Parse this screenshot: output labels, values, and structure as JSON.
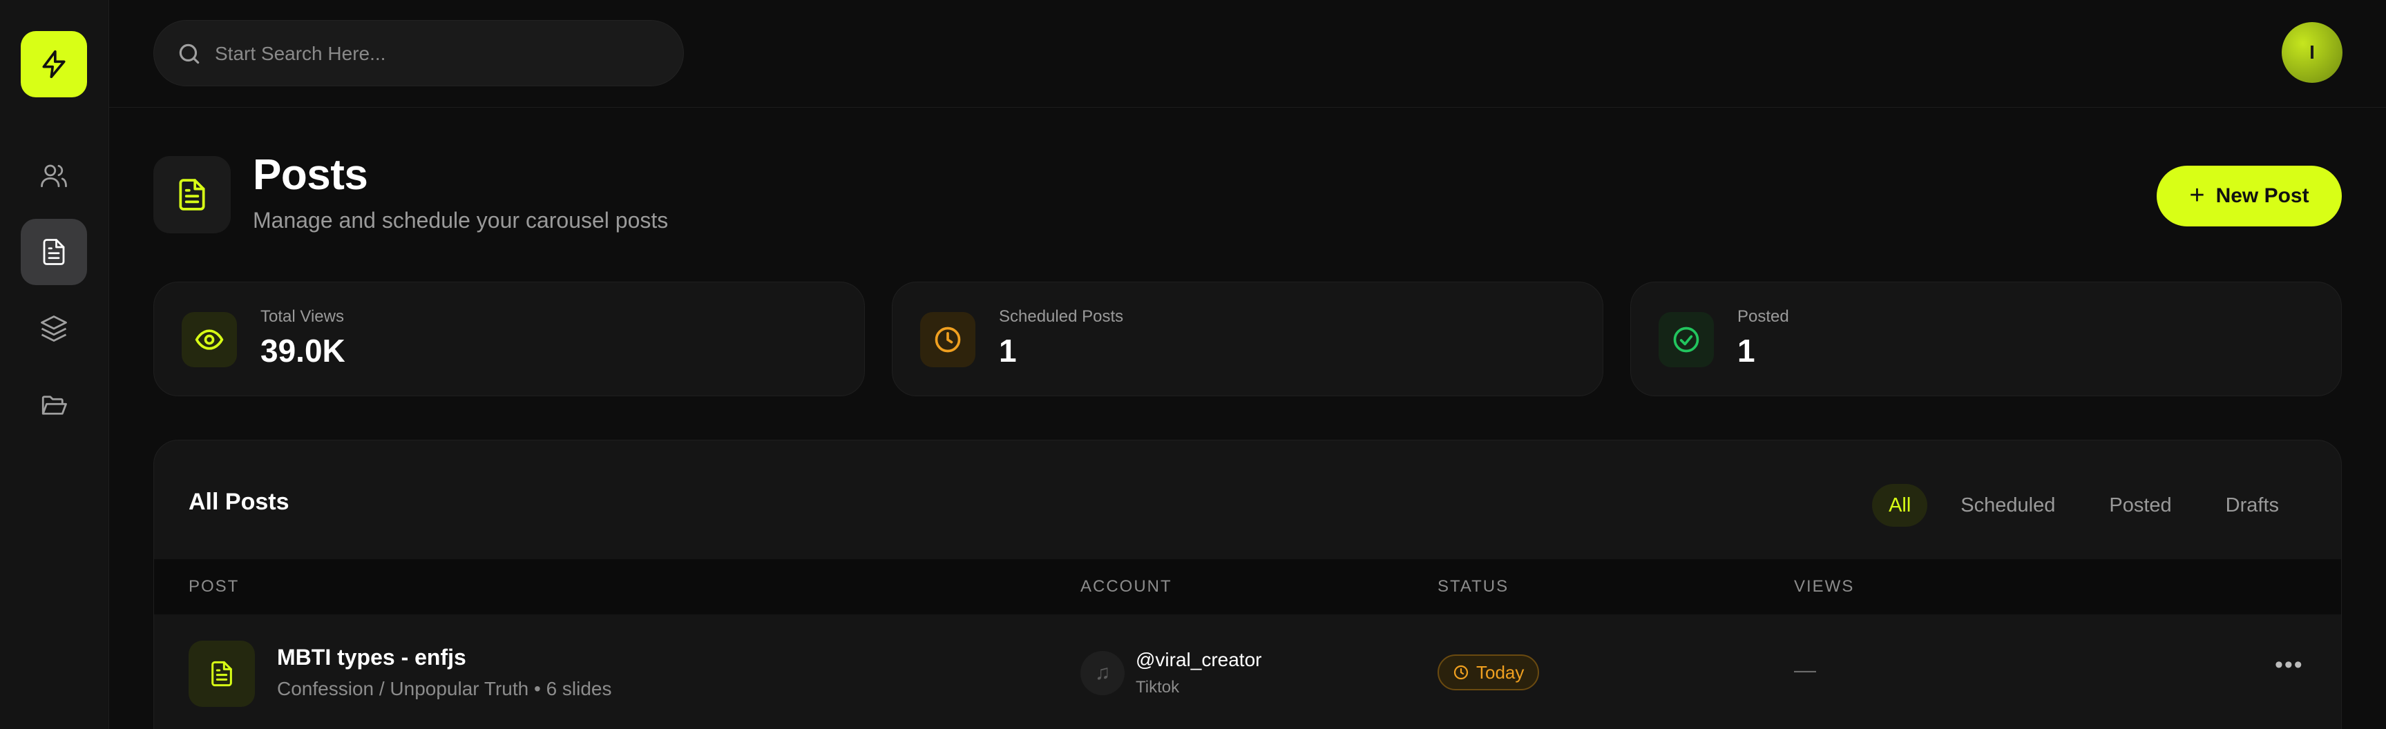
{
  "search": {
    "placeholder": "Start Search Here..."
  },
  "user": {
    "avatar_initial": "I"
  },
  "header": {
    "title": "Posts",
    "subtitle": "Manage and schedule your carousel posts",
    "new_post_label": "New Post"
  },
  "stats": [
    {
      "label": "Total Views",
      "value": "39.0K",
      "color": "#d8ff16",
      "icon": "eye-icon"
    },
    {
      "label": "Scheduled Posts",
      "value": "1",
      "color": "#f0a020",
      "icon": "clock-icon"
    },
    {
      "label": "Posted",
      "value": "1",
      "color": "#22c55e",
      "icon": "check-circle-icon"
    }
  ],
  "posts_panel": {
    "title": "All Posts",
    "filters": [
      "All",
      "Scheduled",
      "Posted",
      "Drafts"
    ],
    "active_filter": "All",
    "columns": [
      "POST",
      "ACCOUNT",
      "STATUS",
      "VIEWS"
    ],
    "rows": [
      {
        "title": "MBTI types - enfjs",
        "meta": "Confession / Unpopular Truth • 6 slides",
        "account_handle": "@viral_creator",
        "account_platform": "Tiktok",
        "status": "Today",
        "views": "—"
      }
    ]
  },
  "colors": {
    "accent": "#d8ff16",
    "background": "#0d0d0d",
    "card": "#151515",
    "warning": "#f0a020",
    "success": "#22c55e"
  }
}
